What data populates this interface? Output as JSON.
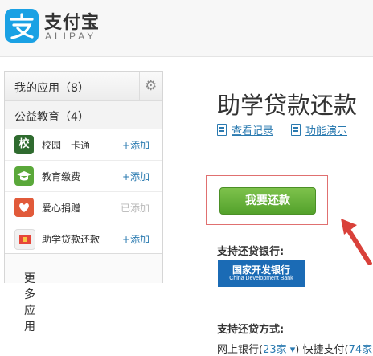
{
  "header": {
    "logo_cn": "支付宝",
    "logo_en": "ALIPAY"
  },
  "sidebar": {
    "my_apps": "我的应用（8）",
    "category": "公益教育（4）",
    "items": [
      {
        "icon_text": "校",
        "label": "校园一卡通",
        "action": "+添加",
        "enabled": true
      },
      {
        "icon_text": "",
        "label": "教育缴费",
        "action": "+添加",
        "enabled": true
      },
      {
        "icon_text": "",
        "label": "爱心捐赠",
        "action": "已添加",
        "enabled": false
      },
      {
        "icon_text": "",
        "label": "助学贷款还款",
        "action": "+添加",
        "enabled": true
      }
    ],
    "more": "更多应用"
  },
  "main": {
    "title": "助学贷款还款",
    "link_records": "查看记录",
    "link_demo": "功能演示",
    "pay_button": "我要还款",
    "banks_label": "支持还贷银行:",
    "bank_cn": "国家开发银行",
    "bank_en": "China Development Bank",
    "methods_label": "支持还贷方式:",
    "methods_text_1": "网上银行(",
    "methods_count_1": "23家",
    "methods_text_2": ")  快捷支付(",
    "methods_count_2": "74家"
  },
  "colors": {
    "brand": "#1aa1e4",
    "link": "#2a7ab0",
    "button": "#5aa83a",
    "highlight": "#e07070"
  }
}
